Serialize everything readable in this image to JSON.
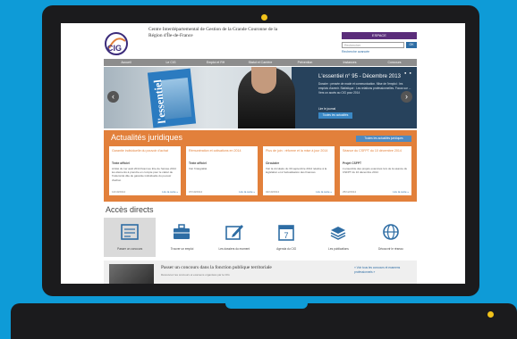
{
  "colors": {
    "background": "#0e9bd7",
    "laptop": "#1b1b1d",
    "led": "#f1c21a",
    "accent_orange": "#e2803b",
    "purple": "#5a2d7a",
    "slider_blue": "#27425c",
    "nav_grey": "#8d8d8d"
  },
  "header": {
    "logo_text": "CIG",
    "org_name": "Centre Interdépartemental de Gestion de la Grande Couronne de la Région d'Île-de-France",
    "espace_label": "ESPACE",
    "search_placeholder": "Rechercher",
    "search_button": "OK",
    "advanced_search": "Recherche avancée"
  },
  "nav": {
    "items": [
      "Accueil",
      "Le CIG",
      "Emploi et RH",
      "Statut et Carrière",
      "Prévention",
      "Instances",
      "Concours"
    ]
  },
  "slider": {
    "magazine_title": "l'essentiel",
    "title": "L'essentiel n° 95 - Décembre 2013",
    "body": "Dossier : pensée de mode et communication. Mise de l'emploi : les emplois d'avenir. Statistique : Les relations professionnelles. Focus sur ... Vers un accès au CIG pour 2014",
    "read_label": "Lire le journal",
    "button": "Toutes les actualités",
    "dots": "● ●",
    "prev": "‹",
    "next": "›"
  },
  "actualites": {
    "title": "Actualités juridiques",
    "all_button": "Toutes les actualités juridiques",
    "cards": [
      {
        "title": "Garantie individuelle du pouvoir d'achat",
        "category": "Texte officiel",
        "text": "Arrêté du 1er août 2014 fixant au titre de l'année 2014 les éléments à prendre en compte pour le calcul de l'indemnité dite de garantie individuelle du pouvoir d'achat.",
        "date": "14/10/2014",
        "more": "Lire la suite »"
      },
      {
        "title": "Rémunération et cotisations en 2014",
        "category": "Texte officiel",
        "text": "Voir l'intégralité",
        "date": "07/10/2014",
        "more": "Lire la suite »"
      },
      {
        "title": "Plus de juin : réforme et la mise à jour 2014",
        "category": "Circulaire",
        "text": "Voir la circulaire du 30 septembre 2014 relative à la législation et à l'actualisation des finances",
        "date": "02/10/2014",
        "more": "Lire la suite »"
      },
      {
        "title": "Séance du CSFPT du 10 décembre 2014",
        "category": "Projet CSFPT",
        "text": "L'ensemble des projets examinés lors de la séance du CSFPT du 10 décembre 2014",
        "date": "25/12/2014",
        "more": "Lire la suite »"
      }
    ]
  },
  "acces": {
    "title": "Accès directs",
    "items": [
      {
        "label": "Passer un concours",
        "icon": "exam-icon"
      },
      {
        "label": "Trouver un emploi",
        "icon": "briefcase-icon"
      },
      {
        "label": "Les dossiers du moment",
        "icon": "edit-icon"
      },
      {
        "label": "Agenda du CIG",
        "icon": "calendar-icon"
      },
      {
        "label": "Les publications",
        "icon": "books-icon"
      },
      {
        "label": "Découvrir le réseau",
        "icon": "globe-icon"
      }
    ],
    "calendar_day": "7"
  },
  "news": {
    "title": "Passer un concours dans la fonction publique territoriale",
    "text": "Découvrez les concours et examens organisés par le CIG",
    "link": "» Voir tous les concours et examens professionnels »"
  }
}
